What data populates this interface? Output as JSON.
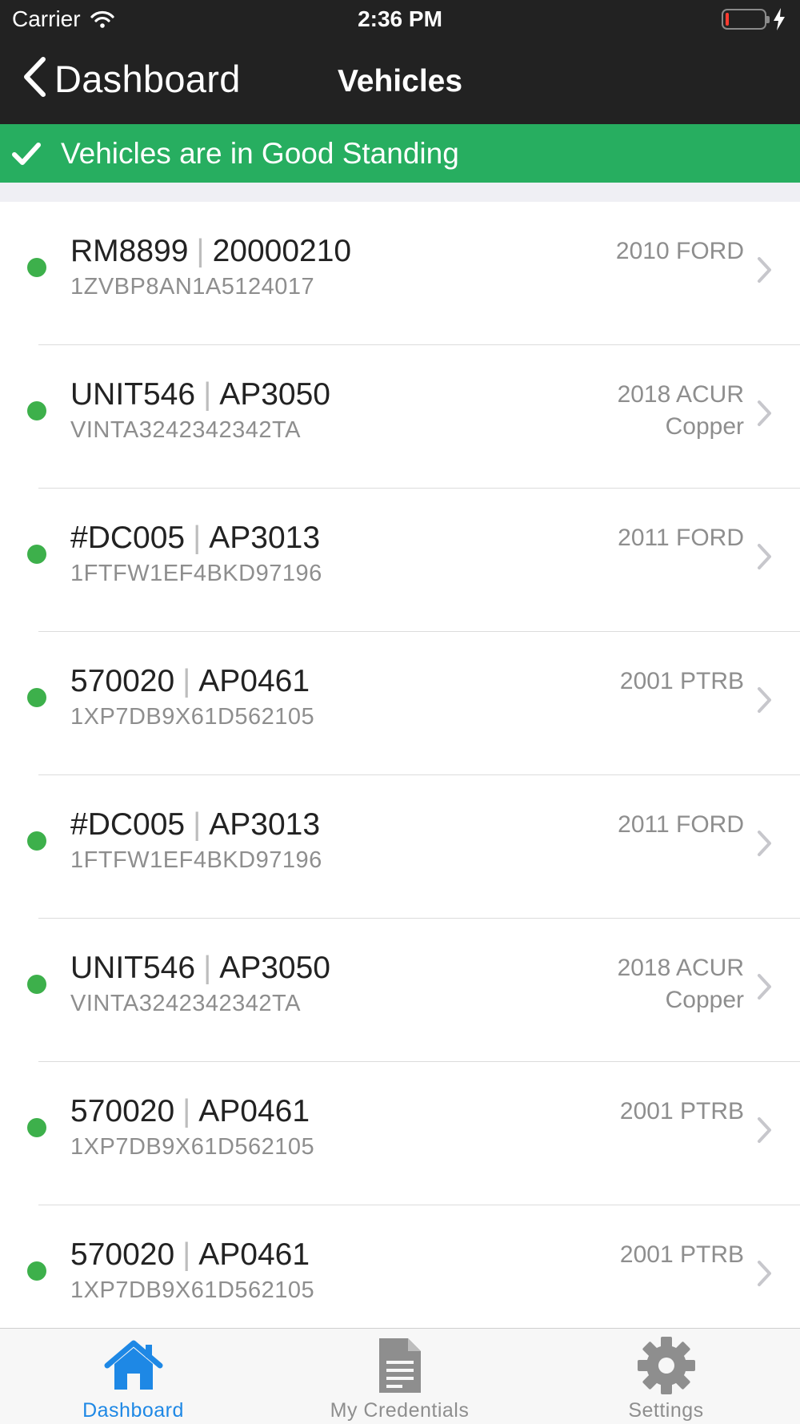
{
  "status_bar": {
    "carrier": "Carrier",
    "time": "2:36 PM"
  },
  "nav": {
    "back_label": "Dashboard",
    "title": "Vehicles"
  },
  "banner": {
    "text": "Vehicles are in Good Standing",
    "color": "#27ae60"
  },
  "vehicles": [
    {
      "unit": "RM8899",
      "plate": "20000210",
      "vin": "1ZVBP8AN1A5124017",
      "year_make": "2010 FORD",
      "color": "",
      "status": "good"
    },
    {
      "unit": "UNIT546",
      "plate": "AP3050",
      "vin": "VINTA3242342342TA",
      "year_make": "2018 ACUR",
      "color": "Copper",
      "status": "good"
    },
    {
      "unit": "#DC005",
      "plate": "AP3013",
      "vin": "1FTFW1EF4BKD97196",
      "year_make": "2011 FORD",
      "color": "",
      "status": "good"
    },
    {
      "unit": "570020",
      "plate": "AP0461",
      "vin": "1XP7DB9X61D562105",
      "year_make": "2001 PTRB",
      "color": "",
      "status": "good"
    },
    {
      "unit": "#DC005",
      "plate": "AP3013",
      "vin": "1FTFW1EF4BKD97196",
      "year_make": "2011 FORD",
      "color": "",
      "status": "good"
    },
    {
      "unit": "UNIT546",
      "plate": "AP3050",
      "vin": "VINTA3242342342TA",
      "year_make": "2018 ACUR",
      "color": "Copper",
      "status": "good"
    },
    {
      "unit": "570020",
      "plate": "AP0461",
      "vin": "1XP7DB9X61D562105",
      "year_make": "2001 PTRB",
      "color": "",
      "status": "good"
    },
    {
      "unit": "570020",
      "plate": "AP0461",
      "vin": "1XP7DB9X61D562105",
      "year_make": "2001 PTRB",
      "color": "",
      "status": "good"
    }
  ],
  "separator": "|",
  "tabs": [
    {
      "label": "Dashboard",
      "icon": "home-icon",
      "active": true
    },
    {
      "label": "My Credentials",
      "icon": "document-icon",
      "active": false
    },
    {
      "label": "Settings",
      "icon": "gear-icon",
      "active": false
    }
  ],
  "colors": {
    "accent": "#1e88e5",
    "status_good": "#3db04b",
    "header_bg": "#222222"
  }
}
